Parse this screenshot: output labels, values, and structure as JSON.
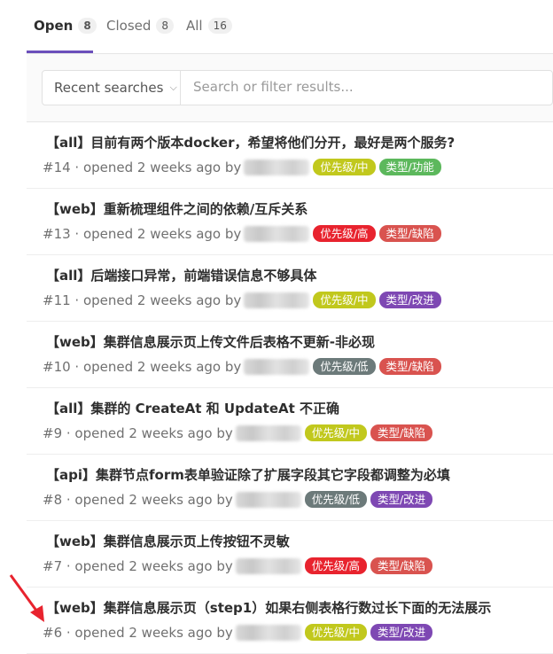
{
  "tabs": [
    {
      "label": "Open",
      "count": "8"
    },
    {
      "label": "Closed",
      "count": "8"
    },
    {
      "label": "All",
      "count": "16"
    }
  ],
  "filter": {
    "recent_label": "Recent searches",
    "search_placeholder": "Search or filter results..."
  },
  "issues": [
    {
      "title": "【all】目前有两个版本docker，希望将他们分开，最好是两个服务?",
      "meta": "#14 · opened 2 weeks ago by",
      "labels": [
        {
          "text": "优先级/中",
          "color": "#c1c81d"
        },
        {
          "text": "类型/功能",
          "color": "#5cb85c"
        }
      ]
    },
    {
      "title": "【web】重新梳理组件之间的依赖/互斥关系",
      "meta": "#13 · opened 2 weeks ago by",
      "labels": [
        {
          "text": "优先级/高",
          "color": "#e8232e"
        },
        {
          "text": "类型/缺陷",
          "color": "#d9534f"
        }
      ]
    },
    {
      "title": "【all】后端接口异常，前端错误信息不够具体",
      "meta": "#11 · opened 2 weeks ago by",
      "labels": [
        {
          "text": "优先级/中",
          "color": "#c1c81d"
        },
        {
          "text": "类型/改进",
          "color": "#7e48b3"
        }
      ]
    },
    {
      "title": "【web】集群信息展示页上传文件后表格不更新-非必现",
      "meta": "#10 · opened 2 weeks ago by",
      "labels": [
        {
          "text": "优先级/低",
          "color": "#6c7a7a"
        },
        {
          "text": "类型/缺陷",
          "color": "#d9534f"
        }
      ]
    },
    {
      "title": "【all】集群的 CreateAt 和 UpdateAt 不正确",
      "meta": "#9 · opened 2 weeks ago by",
      "labels": [
        {
          "text": "优先级/中",
          "color": "#c1c81d"
        },
        {
          "text": "类型/缺陷",
          "color": "#d9534f"
        }
      ]
    },
    {
      "title": "【api】集群节点form表单验证除了扩展字段其它字段都调整为必填",
      "meta": "#8 · opened 2 weeks ago by",
      "labels": [
        {
          "text": "优先级/低",
          "color": "#6c7a7a"
        },
        {
          "text": "类型/改进",
          "color": "#7e48b3"
        }
      ]
    },
    {
      "title": "【web】集群信息展示页上传按钮不灵敏",
      "meta": "#7 · opened 2 weeks ago by",
      "labels": [
        {
          "text": "优先级/高",
          "color": "#e8232e"
        },
        {
          "text": "类型/缺陷",
          "color": "#d9534f"
        }
      ]
    },
    {
      "title": "【web】集群信息展示页（step1）如果右侧表格行数过长下面的无法展示",
      "meta": "#6 · opened 2 weeks ago by",
      "labels": [
        {
          "text": "优先级/中",
          "color": "#c1c81d"
        },
        {
          "text": "类型/改进",
          "color": "#7e48b3"
        }
      ]
    }
  ]
}
